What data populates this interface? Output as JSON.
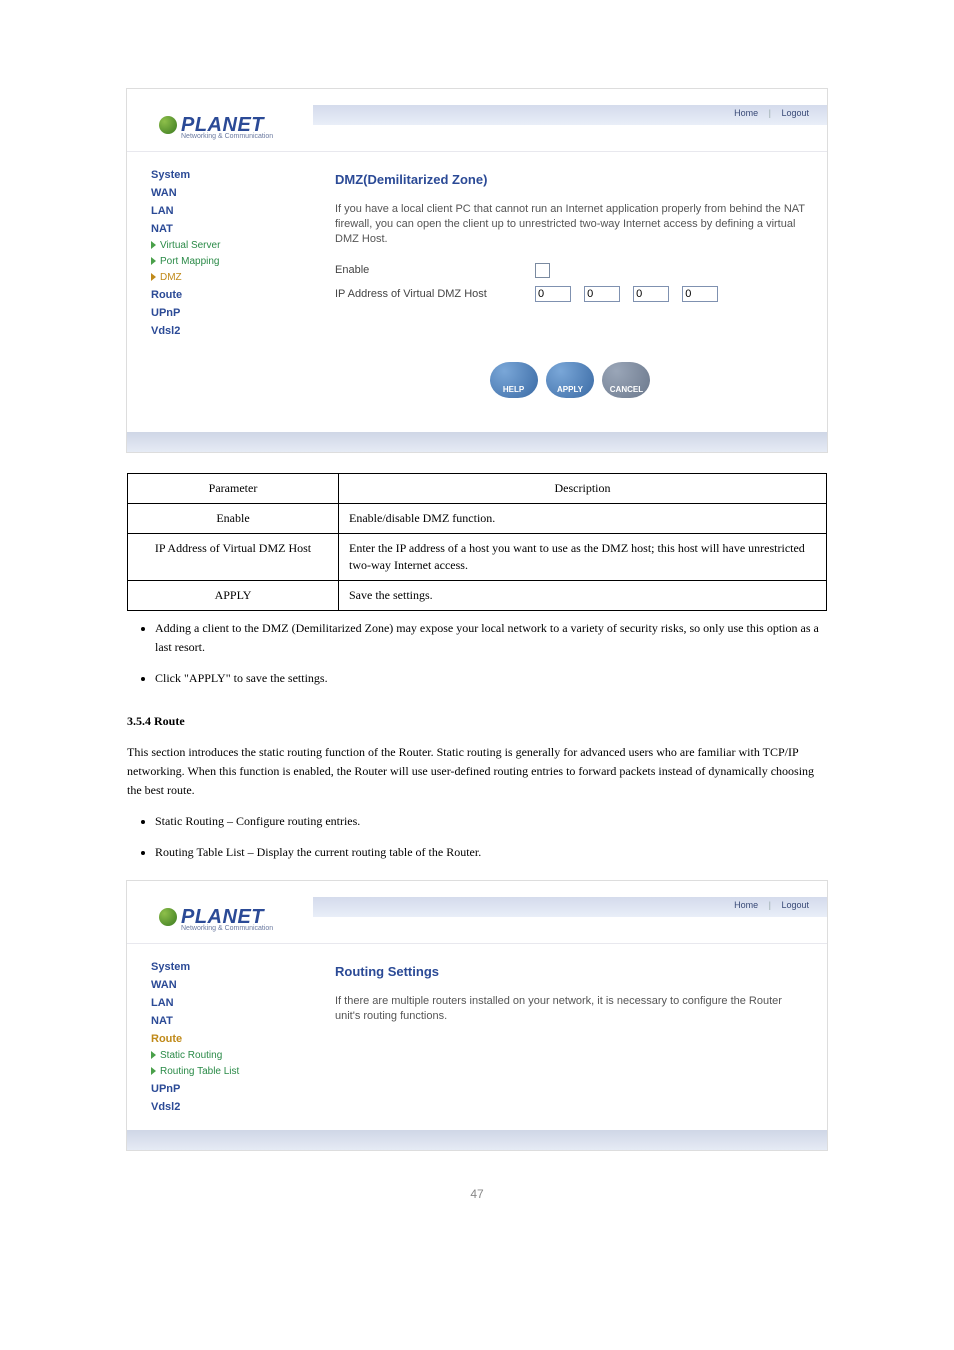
{
  "page_number": "47",
  "logo": {
    "brand": "PLANET",
    "tagline": "Networking & Communication"
  },
  "toplinks": {
    "home": "Home",
    "logout": "Logout"
  },
  "shot1": {
    "nav": {
      "system": "System",
      "wan": "WAN",
      "lan": "LAN",
      "nat": "NAT",
      "virtual_server": "Virtual Server",
      "port_mapping": "Port Mapping",
      "dmz": "DMZ",
      "route": "Route",
      "upnp": "UPnP",
      "vdsl2": "Vdsl2"
    },
    "title": "DMZ(Demilitarized Zone)",
    "desc": "If you have a local client PC that cannot run an Internet application properly from behind the NAT firewall, you can open the client up to unrestricted two-way Internet access by defining a virtual DMZ Host.",
    "enable_label": "Enable",
    "ip_label": "IP Address of Virtual DMZ Host",
    "ip": {
      "a": "0",
      "b": "0",
      "c": "0",
      "d": "0"
    },
    "buttons": {
      "help": "HELP",
      "apply": "APPLY",
      "cancel": "CANCEL"
    }
  },
  "ptable": {
    "h_param": "Parameter",
    "h_desc": "Description",
    "rows": [
      {
        "p": "Enable",
        "d": "Enable/disable DMZ function."
      },
      {
        "p": "IP Address of Virtual DMZ Host",
        "d": "Enter the IP address of a host you want to use as the DMZ host; this host will have unrestricted two-way Internet access."
      },
      {
        "p": "APPLY",
        "d": "Save the settings."
      }
    ]
  },
  "notes": {
    "li1": "Adding a client to the DMZ (Demilitarized Zone) may expose your local network to a variety of security risks, so only use this option as a last resort.",
    "li2": "Click \"APPLY\" to save the settings."
  },
  "sect": {
    "no": "3.5.4 Route",
    "p": "This section introduces the static routing function of the Router. Static routing is generally for advanced users who are familiar with TCP/IP networking. When this function is enabled, the Router will use user-defined routing entries to forward packets instead of dynamically choosing the best route.",
    "li_a": "Static Routing – Configure routing entries.",
    "li_b": "Routing Table List – Display the current routing table of the Router."
  },
  "shot2": {
    "nav": {
      "system": "System",
      "wan": "WAN",
      "lan": "LAN",
      "nat": "NAT",
      "route": "Route",
      "static_routing": "Static Routing",
      "routing_table": "Routing Table List",
      "upnp": "UPnP",
      "vdsl2": "Vdsl2"
    },
    "title": "Routing Settings",
    "desc": "If there are multiple routers installed on your network, it is necessary to configure the Router unit's routing functions."
  }
}
